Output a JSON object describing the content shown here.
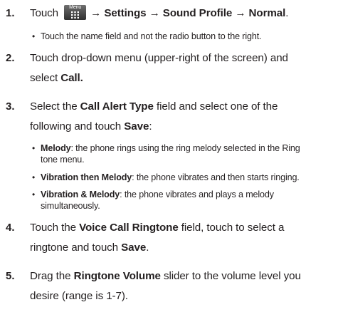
{
  "steps": [
    {
      "num": "1.",
      "before_icon": "Touch",
      "icon_label": "Menu",
      "after_icon": "→ Settings → Sound Profile → Normal",
      "end": "."
    },
    {
      "num": "2.",
      "line1": "Touch drop-down menu (upper-right of the screen) and",
      "line2_pre": "select ",
      "line2_bold": "Call."
    },
    {
      "num": "3.",
      "l1_pre": "Select the ",
      "l1_bold": "Call Alert Type",
      "l1_post": " field and select one of the",
      "l2_pre": "following and touch ",
      "l2_bold": "Save",
      "l2_post": ":"
    },
    {
      "num": "4.",
      "l1_pre": "Touch the ",
      "l1_bold": "Voice Call Ringtone",
      "l1_post": " field, touch to select a",
      "l2_pre": "ringtone and touch ",
      "l2_bold": "Save",
      "l2_post": "."
    },
    {
      "num": "5.",
      "l1_pre": "Drag the ",
      "l1_bold": "Ringtone Volume",
      "l1_post": " slider to the volume level you",
      "l2": "desire (range is 1-7)."
    }
  ],
  "bullets": {
    "step1": "Touch the name field and not the radio button to the right.",
    "step3": [
      {
        "term": "Melody",
        "line1": ": the phone rings using the ring melody selected in the Ring",
        "line2": "tone menu."
      },
      {
        "term": "Vibration then Melody",
        "line1": ": the phone vibrates and then starts ringing.",
        "line2": ""
      },
      {
        "term": "Vibration & Melody",
        "line1": ": the phone vibrates and plays a melody",
        "line2": "simultaneously."
      }
    ]
  },
  "icons": {
    "menu": "menu-grid-icon"
  }
}
